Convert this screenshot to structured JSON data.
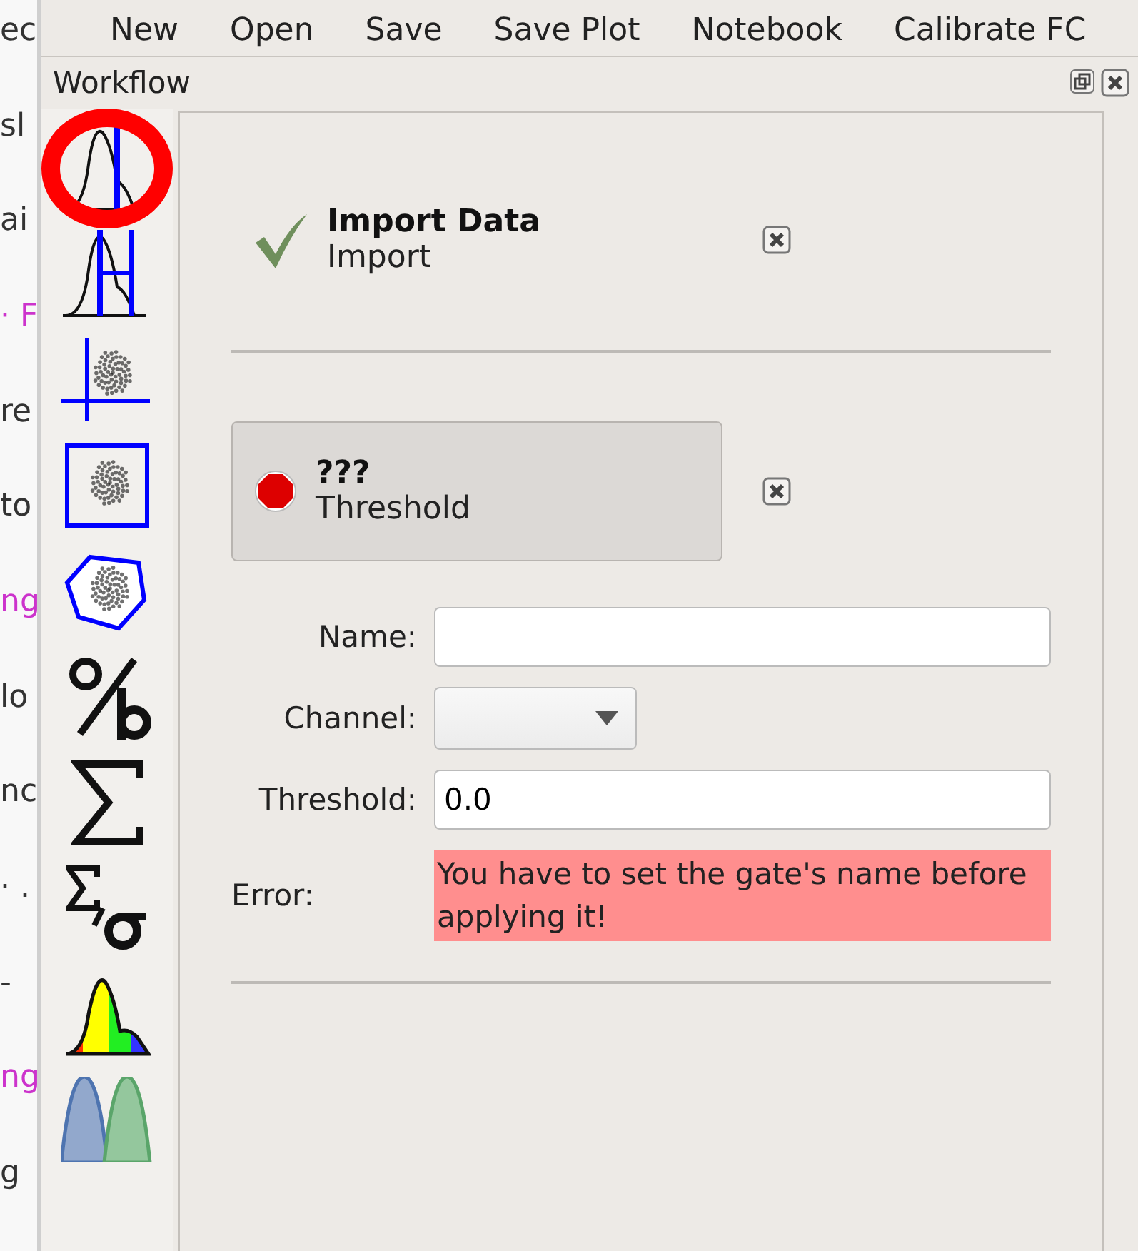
{
  "background_fragments": [
    {
      "text": "ec",
      "color": "#333333"
    },
    {
      "text": "sl",
      "color": "#333333"
    },
    {
      "text": "ai",
      "color": "#333333"
    },
    {
      "text": "· F",
      "color": "#cc33cc"
    },
    {
      "text": "re",
      "color": "#333333"
    },
    {
      "text": "to",
      "color": "#333333"
    },
    {
      "text": "ng",
      "color": "#cc33cc"
    },
    {
      "text": "lo",
      "color": "#333333"
    },
    {
      "text": "nc",
      "color": "#333333"
    },
    {
      "text": "· .",
      "color": "#333333"
    },
    {
      "text": "-",
      "color": "#333333"
    },
    {
      "text": "ng",
      "color": "#cc33cc"
    },
    {
      "text": "g",
      "color": "#333333"
    }
  ],
  "toolbar": [
    "New",
    "Open",
    "Save",
    "Save Plot",
    "Notebook",
    "Calibrate FC"
  ],
  "dock": {
    "title": "Workflow"
  },
  "tools": [
    {
      "kind": "histogram",
      "selected": true
    },
    {
      "kind": "range",
      "selected": false
    },
    {
      "kind": "quad",
      "selected": false
    },
    {
      "kind": "rect",
      "selected": false
    },
    {
      "kind": "polygon",
      "selected": false
    },
    {
      "kind": "ratio",
      "selected": false
    },
    {
      "kind": "sum",
      "selected": false
    },
    {
      "kind": "stats",
      "selected": false
    },
    {
      "kind": "colorhist",
      "selected": false
    },
    {
      "kind": "overlay",
      "selected": false
    }
  ],
  "steps": [
    {
      "complete": true,
      "name": "Import Data",
      "type": "Import",
      "expanded": false
    },
    {
      "complete": false,
      "name": "???",
      "type": "Threshold",
      "expanded": true,
      "form": {
        "name_label": "Name:",
        "channel_label": "Channel:",
        "threshold_label": "Threshold:",
        "threshold_value": "0.0",
        "error_label": "Error:",
        "error_text": "You have to set the gate's name before applying it!"
      }
    }
  ]
}
